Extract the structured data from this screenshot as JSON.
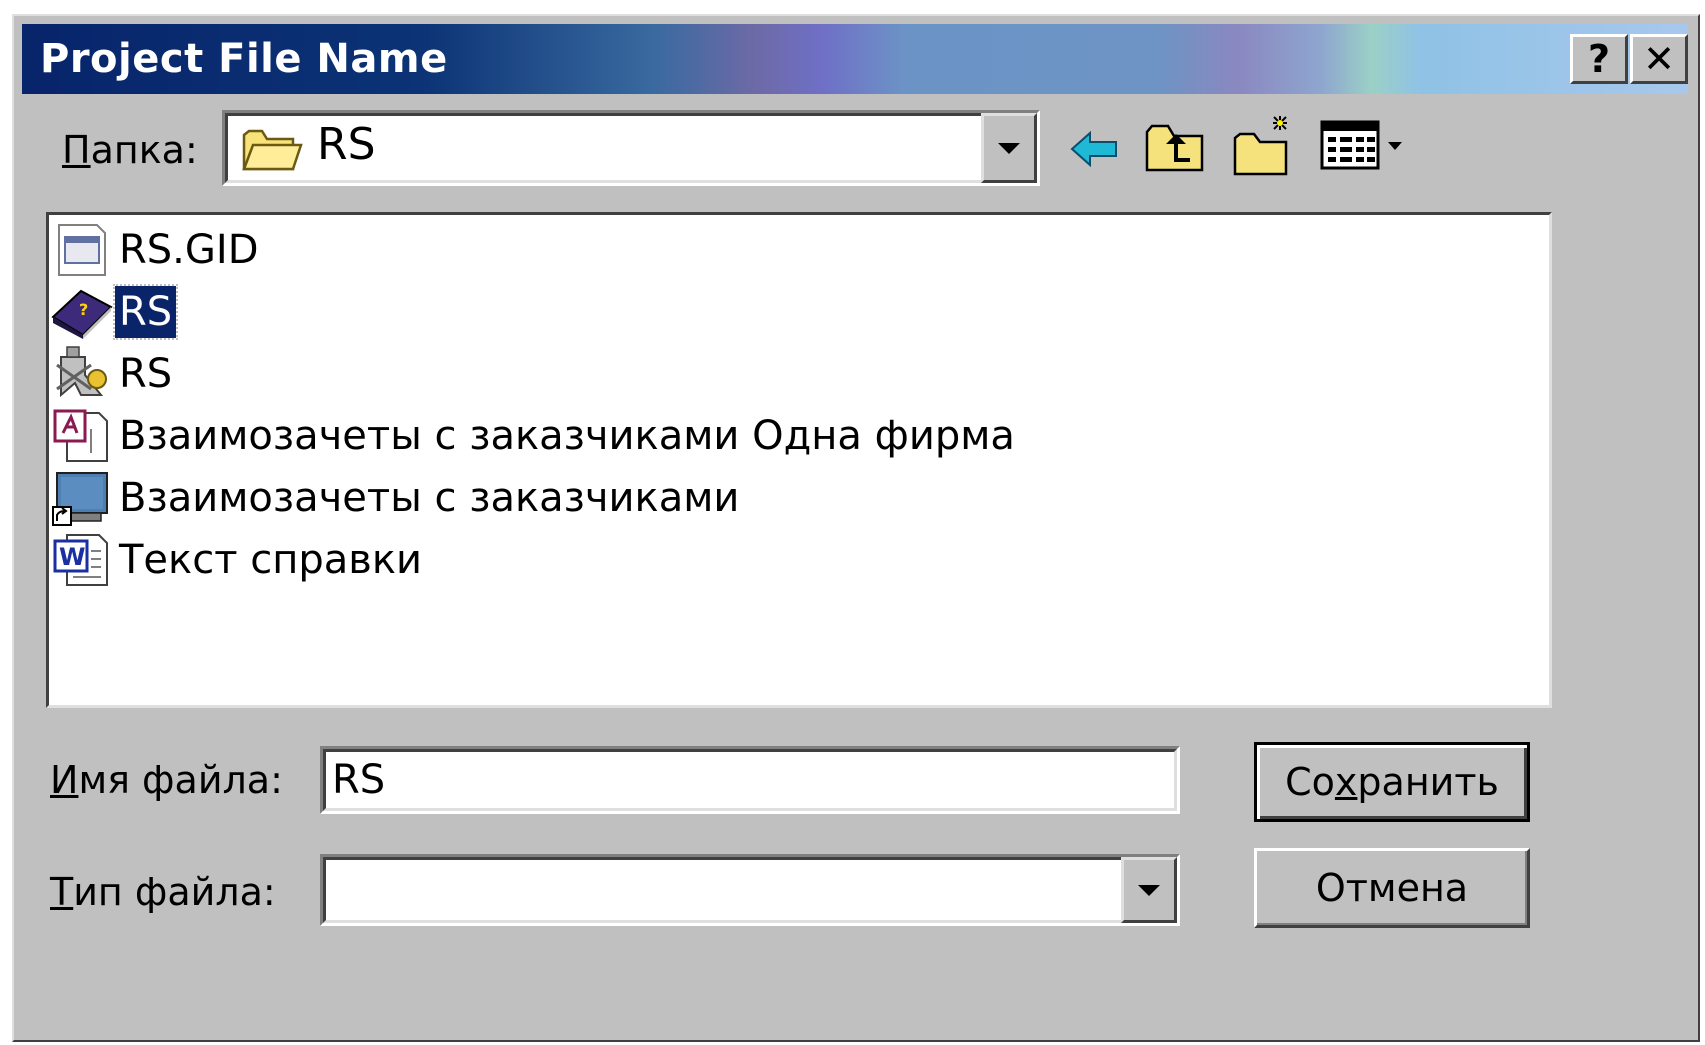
{
  "dialog": {
    "title": "Project File Name",
    "help_label": "?",
    "close_label": "✕"
  },
  "folder": {
    "label_rest": "апка:",
    "label_mnemonic": "П",
    "value": "RS"
  },
  "toolbar": {
    "icons": [
      "back-arrow-icon",
      "up-folder-icon",
      "new-folder-icon",
      "view-menu-icon"
    ]
  },
  "files": [
    {
      "name": "RS.GID",
      "icon": "gid-file-icon",
      "selected": false
    },
    {
      "name": "RS",
      "icon": "help-book-icon",
      "selected": true
    },
    {
      "name": "RS",
      "icon": "help-project-icon",
      "selected": false
    },
    {
      "name": "Взаимозачеты с заказчиками Одна фирма",
      "icon": "access-document-icon",
      "selected": false
    },
    {
      "name": "Взаимозачеты с заказчиками",
      "icon": "shortcut-icon",
      "selected": false
    },
    {
      "name": "Текст  справки",
      "icon": "word-document-icon",
      "selected": false
    }
  ],
  "filename": {
    "label_mnemonic": "И",
    "label_rest": "мя файла:",
    "value": "RS"
  },
  "filetype": {
    "label_mnemonic": "Т",
    "label_rest": "ип файла:",
    "value": ""
  },
  "buttons": {
    "save_pre": "Со",
    "save_mnemonic": "х",
    "save_post": "ранить",
    "cancel": "Отмена"
  },
  "colors": {
    "face": "#c0c0c0",
    "selection": "#0a246a",
    "title_dark": "#08246b"
  }
}
